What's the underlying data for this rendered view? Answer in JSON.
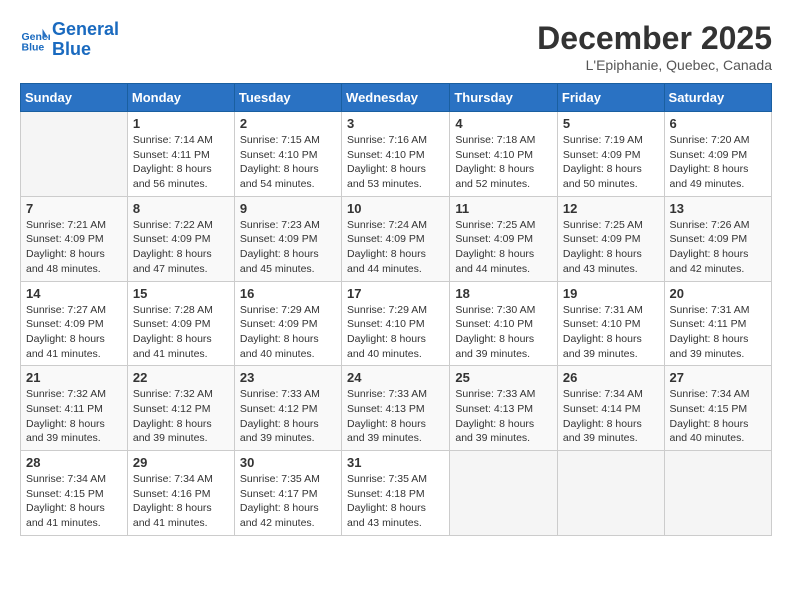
{
  "header": {
    "logo_line1": "General",
    "logo_line2": "Blue",
    "month": "December 2025",
    "location": "L'Epiphanie, Quebec, Canada"
  },
  "days_of_week": [
    "Sunday",
    "Monday",
    "Tuesday",
    "Wednesday",
    "Thursday",
    "Friday",
    "Saturday"
  ],
  "weeks": [
    [
      {
        "day": "",
        "info": ""
      },
      {
        "day": "1",
        "info": "Sunrise: 7:14 AM\nSunset: 4:11 PM\nDaylight: 8 hours\nand 56 minutes."
      },
      {
        "day": "2",
        "info": "Sunrise: 7:15 AM\nSunset: 4:10 PM\nDaylight: 8 hours\nand 54 minutes."
      },
      {
        "day": "3",
        "info": "Sunrise: 7:16 AM\nSunset: 4:10 PM\nDaylight: 8 hours\nand 53 minutes."
      },
      {
        "day": "4",
        "info": "Sunrise: 7:18 AM\nSunset: 4:10 PM\nDaylight: 8 hours\nand 52 minutes."
      },
      {
        "day": "5",
        "info": "Sunrise: 7:19 AM\nSunset: 4:09 PM\nDaylight: 8 hours\nand 50 minutes."
      },
      {
        "day": "6",
        "info": "Sunrise: 7:20 AM\nSunset: 4:09 PM\nDaylight: 8 hours\nand 49 minutes."
      }
    ],
    [
      {
        "day": "7",
        "info": "Sunrise: 7:21 AM\nSunset: 4:09 PM\nDaylight: 8 hours\nand 48 minutes."
      },
      {
        "day": "8",
        "info": "Sunrise: 7:22 AM\nSunset: 4:09 PM\nDaylight: 8 hours\nand 47 minutes."
      },
      {
        "day": "9",
        "info": "Sunrise: 7:23 AM\nSunset: 4:09 PM\nDaylight: 8 hours\nand 45 minutes."
      },
      {
        "day": "10",
        "info": "Sunrise: 7:24 AM\nSunset: 4:09 PM\nDaylight: 8 hours\nand 44 minutes."
      },
      {
        "day": "11",
        "info": "Sunrise: 7:25 AM\nSunset: 4:09 PM\nDaylight: 8 hours\nand 44 minutes."
      },
      {
        "day": "12",
        "info": "Sunrise: 7:25 AM\nSunset: 4:09 PM\nDaylight: 8 hours\nand 43 minutes."
      },
      {
        "day": "13",
        "info": "Sunrise: 7:26 AM\nSunset: 4:09 PM\nDaylight: 8 hours\nand 42 minutes."
      }
    ],
    [
      {
        "day": "14",
        "info": "Sunrise: 7:27 AM\nSunset: 4:09 PM\nDaylight: 8 hours\nand 41 minutes."
      },
      {
        "day": "15",
        "info": "Sunrise: 7:28 AM\nSunset: 4:09 PM\nDaylight: 8 hours\nand 41 minutes."
      },
      {
        "day": "16",
        "info": "Sunrise: 7:29 AM\nSunset: 4:09 PM\nDaylight: 8 hours\nand 40 minutes."
      },
      {
        "day": "17",
        "info": "Sunrise: 7:29 AM\nSunset: 4:10 PM\nDaylight: 8 hours\nand 40 minutes."
      },
      {
        "day": "18",
        "info": "Sunrise: 7:30 AM\nSunset: 4:10 PM\nDaylight: 8 hours\nand 39 minutes."
      },
      {
        "day": "19",
        "info": "Sunrise: 7:31 AM\nSunset: 4:10 PM\nDaylight: 8 hours\nand 39 minutes."
      },
      {
        "day": "20",
        "info": "Sunrise: 7:31 AM\nSunset: 4:11 PM\nDaylight: 8 hours\nand 39 minutes."
      }
    ],
    [
      {
        "day": "21",
        "info": "Sunrise: 7:32 AM\nSunset: 4:11 PM\nDaylight: 8 hours\nand 39 minutes."
      },
      {
        "day": "22",
        "info": "Sunrise: 7:32 AM\nSunset: 4:12 PM\nDaylight: 8 hours\nand 39 minutes."
      },
      {
        "day": "23",
        "info": "Sunrise: 7:33 AM\nSunset: 4:12 PM\nDaylight: 8 hours\nand 39 minutes."
      },
      {
        "day": "24",
        "info": "Sunrise: 7:33 AM\nSunset: 4:13 PM\nDaylight: 8 hours\nand 39 minutes."
      },
      {
        "day": "25",
        "info": "Sunrise: 7:33 AM\nSunset: 4:13 PM\nDaylight: 8 hours\nand 39 minutes."
      },
      {
        "day": "26",
        "info": "Sunrise: 7:34 AM\nSunset: 4:14 PM\nDaylight: 8 hours\nand 39 minutes."
      },
      {
        "day": "27",
        "info": "Sunrise: 7:34 AM\nSunset: 4:15 PM\nDaylight: 8 hours\nand 40 minutes."
      }
    ],
    [
      {
        "day": "28",
        "info": "Sunrise: 7:34 AM\nSunset: 4:15 PM\nDaylight: 8 hours\nand 41 minutes."
      },
      {
        "day": "29",
        "info": "Sunrise: 7:34 AM\nSunset: 4:16 PM\nDaylight: 8 hours\nand 41 minutes."
      },
      {
        "day": "30",
        "info": "Sunrise: 7:35 AM\nSunset: 4:17 PM\nDaylight: 8 hours\nand 42 minutes."
      },
      {
        "day": "31",
        "info": "Sunrise: 7:35 AM\nSunset: 4:18 PM\nDaylight: 8 hours\nand 43 minutes."
      },
      {
        "day": "",
        "info": ""
      },
      {
        "day": "",
        "info": ""
      },
      {
        "day": "",
        "info": ""
      }
    ]
  ]
}
